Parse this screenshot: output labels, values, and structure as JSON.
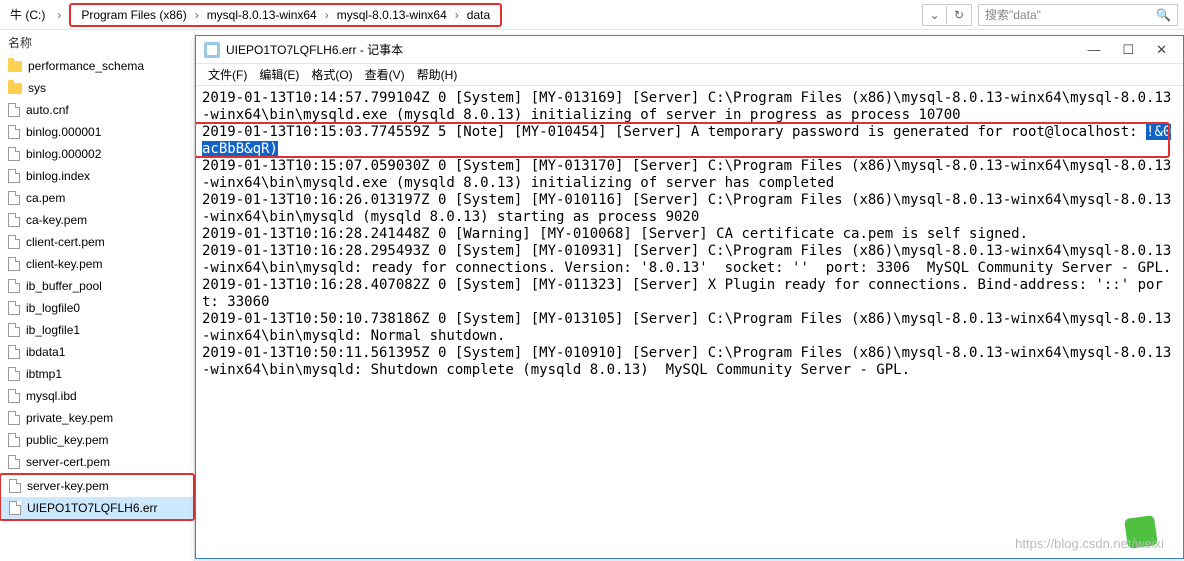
{
  "breadcrumb": {
    "root": "牛 (C:)",
    "parts": [
      "Program Files (x86)",
      "mysql-8.0.13-winx64",
      "mysql-8.0.13-winx64",
      "data"
    ]
  },
  "search": {
    "placeholder": "搜索\"data\""
  },
  "sidebar": {
    "header": "名称",
    "items": [
      {
        "type": "folder",
        "label": "performance_schema"
      },
      {
        "type": "folder",
        "label": "sys"
      },
      {
        "type": "file",
        "label": "auto.cnf"
      },
      {
        "type": "file",
        "label": "binlog.000001"
      },
      {
        "type": "file",
        "label": "binlog.000002"
      },
      {
        "type": "file",
        "label": "binlog.index"
      },
      {
        "type": "file",
        "label": "ca.pem"
      },
      {
        "type": "file",
        "label": "ca-key.pem"
      },
      {
        "type": "file",
        "label": "client-cert.pem"
      },
      {
        "type": "file",
        "label": "client-key.pem"
      },
      {
        "type": "file",
        "label": "ib_buffer_pool"
      },
      {
        "type": "file",
        "label": "ib_logfile0"
      },
      {
        "type": "file",
        "label": "ib_logfile1"
      },
      {
        "type": "file",
        "label": "ibdata1"
      },
      {
        "type": "file",
        "label": "ibtmp1"
      },
      {
        "type": "file",
        "label": "mysql.ibd"
      },
      {
        "type": "file",
        "label": "private_key.pem"
      },
      {
        "type": "file",
        "label": "public_key.pem"
      },
      {
        "type": "file",
        "label": "server-cert.pem"
      },
      {
        "type": "file",
        "label": "server-key.pem"
      },
      {
        "type": "file",
        "label": "UIEPO1TO7LQFLH6.err",
        "selected": true
      }
    ]
  },
  "notepad": {
    "title": "UIEPO1TO7LQFLH6.err - 记事本",
    "menu": {
      "file": "文件(F)",
      "edit": "编辑(E)",
      "format": "格式(O)",
      "view": "查看(V)",
      "help": "帮助(H)"
    },
    "log": {
      "l1": "2019-01-13T10:14:57.799104Z 0 [System] [MY-013169] [Server] C:\\Program Files (x86)\\mysql-8.0.13-winx64\\mysql-8.0.13-winx64\\bin\\mysqld.exe (mysqld 8.0.13) initializing of server in progress as process 10700",
      "l2a": "2019-01-13T10:15:03.774559Z 5 [Note] [MY-010454] [Server] A temporary password is generated for root@localhost: ",
      "l2b": "!&0acBbB&qR)",
      "l3": "2019-01-13T10:15:07.059030Z 0 [System] [MY-013170] [Server] C:\\Program Files (x86)\\mysql-8.0.13-winx64\\mysql-8.0.13-winx64\\bin\\mysqld.exe (mysqld 8.0.13) initializing of server has completed",
      "l4": "2019-01-13T10:16:26.013197Z 0 [System] [MY-010116] [Server] C:\\Program Files (x86)\\mysql-8.0.13-winx64\\mysql-8.0.13-winx64\\bin\\mysqld (mysqld 8.0.13) starting as process 9020",
      "l5": "2019-01-13T10:16:28.241448Z 0 [Warning] [MY-010068] [Server] CA certificate ca.pem is self signed.",
      "l6": "2019-01-13T10:16:28.295493Z 0 [System] [MY-010931] [Server] C:\\Program Files (x86)\\mysql-8.0.13-winx64\\mysql-8.0.13-winx64\\bin\\mysqld: ready for connections. Version: '8.0.13'  socket: ''  port: 3306  MySQL Community Server - GPL.",
      "l7": "2019-01-13T10:16:28.407082Z 0 [System] [MY-011323] [Server] X Plugin ready for connections. Bind-address: '::' port: 33060",
      "l8": "2019-01-13T10:50:10.738186Z 0 [System] [MY-013105] [Server] C:\\Program Files (x86)\\mysql-8.0.13-winx64\\mysql-8.0.13-winx64\\bin\\mysqld: Normal shutdown.",
      "l9": "2019-01-13T10:50:11.561395Z 0 [System] [MY-010910] [Server] C:\\Program Files (x86)\\mysql-8.0.13-winx64\\mysql-8.0.13-winx64\\bin\\mysqld: Shutdown complete (mysqld 8.0.13)  MySQL Community Server - GPL."
    }
  },
  "watermark": "https://blog.csdn.net/weixi"
}
